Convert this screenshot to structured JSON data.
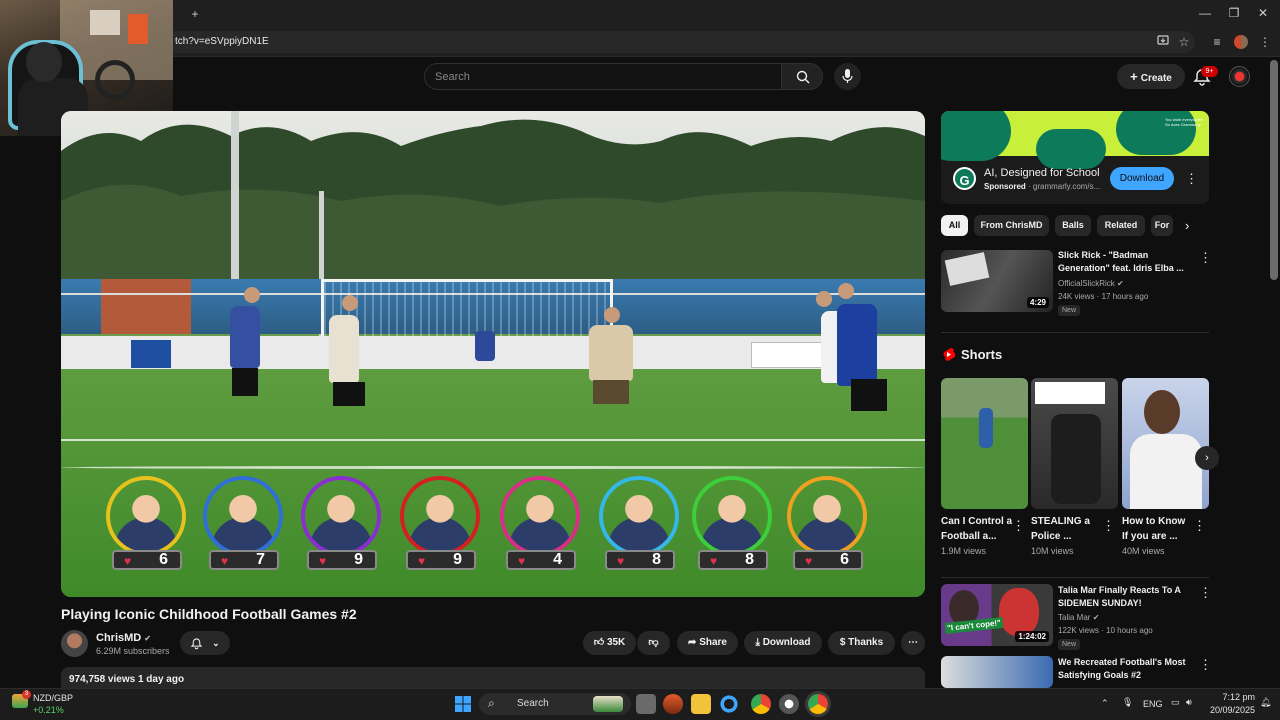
{
  "browser": {
    "url_fragment": "tch?v=eSVppiyDN1E",
    "new_tab_glyph": "+",
    "window_controls": [
      "—",
      "❐",
      "✕"
    ]
  },
  "header": {
    "search_placeholder": "Search",
    "create_label": "Create",
    "notifications_badge": "9+"
  },
  "player": {
    "scores": [
      {
        "value": "6",
        "border": "#e8c21c"
      },
      {
        "value": "7",
        "border": "#2f6fd6"
      },
      {
        "value": "9",
        "border": "#8a2ed0"
      },
      {
        "value": "9",
        "border": "#d42020"
      },
      {
        "value": "4",
        "border": "#d82e86"
      },
      {
        "value": "8",
        "border": "#35b7e8"
      },
      {
        "value": "8",
        "border": "#3dcf3a"
      },
      {
        "value": "6",
        "border": "#f0a020"
      }
    ]
  },
  "video": {
    "title": "Playing Iconic Childhood Football Games #2",
    "channel": "ChrisMD",
    "verified": "✔",
    "subscribers": "6.29M subscribers",
    "likes": "35K",
    "share_label": "Share",
    "download_label": "Download",
    "thanks_label": "Thanks",
    "views_date": "974,758 views  1 day ago"
  },
  "ad": {
    "banner_text": "You work everywhere. So does Grammarly.",
    "title": "AI, Designed for School",
    "sponsored": "Sponsored",
    "domain": "· grammarly.com/s...",
    "button": "Download",
    "logo": "G"
  },
  "chips": [
    "All",
    "From ChrisMD",
    "Balls",
    "Related",
    "For"
  ],
  "recommended": [
    {
      "title": "Slick Rick - \"Badman Generation\" feat. Idris Elba ...",
      "channel": "OfficialSlickRick",
      "meta": "24K views · 17 hours ago",
      "duration": "4:29",
      "tag": "New"
    },
    {
      "title": "Talia Mar Finally Reacts To A SIDEMEN SUNDAY!",
      "channel": "Talia Mar",
      "meta": "122K views · 10 hours ago",
      "duration": "1:24:02",
      "tag": "New",
      "thumb_caption": "\"I can't cope!\""
    },
    {
      "title": "We Recreated Football's Most Satisfying Goals #2",
      "channel": "",
      "meta": "",
      "duration": "",
      "tag": ""
    }
  ],
  "shorts": {
    "heading": "Shorts",
    "items": [
      {
        "title": "Can I Control a Football a...",
        "views": "1.9M views"
      },
      {
        "title": "STEALING a Police ...",
        "views": "10M views"
      },
      {
        "title": "How to Know If you are ...",
        "views": "40M views"
      }
    ]
  },
  "taskbar": {
    "ticker_name": "NZD/GBP",
    "ticker_change": "+0.21%",
    "ticker_badge": "3",
    "search_label": "Search",
    "language": "ENG",
    "time": "7:12 pm",
    "date": "20/09/2025"
  },
  "colors": {
    "accent_blue": "#3ea6ff",
    "brand_red": "#ff0000",
    "background": "#0f0f0f",
    "grammarly_lime": "#c8ef3a",
    "grammarly_green": "#0d7a5a"
  }
}
